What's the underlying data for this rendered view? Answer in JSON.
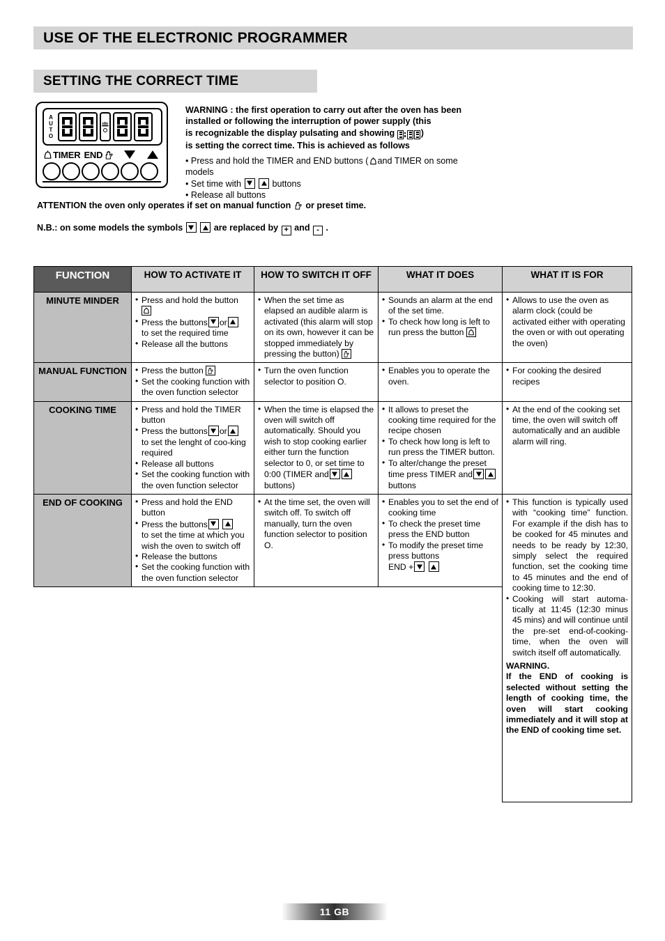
{
  "headings": {
    "main": "USE OF THE ELECTRONIC PROGRAMMER",
    "sub": "SETTING THE CORRECT TIME"
  },
  "panel": {
    "auto_label": "AUTO",
    "auto_letters": [
      "A",
      "U",
      "T",
      "O"
    ],
    "digit_value": "8",
    "labels": {
      "bell_icon": "bell-icon",
      "timer": "TIMER",
      "end": "END",
      "hand_icon": "hand-icon",
      "down_icon": "triangle-down-icon",
      "up_icon": "triangle-up-icon"
    },
    "button_count": 6
  },
  "warning": {
    "line1": "WARNING : the first operation to carry out after the oven has been",
    "line2": "installed or following the interruption of power supply (this",
    "line3_pre": "is recognizable the display pulsating and showing",
    "line3_post": ")",
    "line4": "is setting the correct time. This is achieved as follows",
    "bullet1_a": "Press and hold the TIMER and END buttons (",
    "bullet1_b": "and TIMER on some",
    "bullet1_c": "models",
    "bullet2_a": "Set time with",
    "bullet2_b": "buttons",
    "bullet3": "Release all buttons"
  },
  "attention": {
    "pre": "ATTENTION the oven only operates if set on manual function",
    "post": "or preset time."
  },
  "nb": {
    "pre": "N.B.: on some models the symbols",
    "mid": "are replaced by",
    "plus": "+",
    "and": "and",
    "minus": "-",
    "post": "."
  },
  "table": {
    "headers": [
      "FUNCTION",
      "HOW TO ACTIVATE IT",
      "HOW TO SWITCH IT OFF",
      "WHAT IT DOES",
      "WHAT IT IS FOR"
    ],
    "rows": {
      "minute_minder": {
        "name": "MINUTE MINDER",
        "activate": [
          "Press and hold the button",
          "Press the buttons",
          "to set the required time",
          "Release all the buttons"
        ],
        "switch_off": [
          "When the set time as elapsed an audible alarm is activated (this alarm will stop on its own, however it can be stopped immediately by pressing the button)"
        ],
        "does": [
          "Sounds an alarm at the end of the set time.",
          "To check how long is left to run press the button"
        ],
        "for": [
          "Allows to use the oven as alarm clock (could be activated either with operating the oven or with out operating the oven)"
        ]
      },
      "manual_function": {
        "name": "MANUAL FUNCTION",
        "activate": [
          "Press the button",
          "Set the cooking function with the oven function selector"
        ],
        "switch_off": [
          "Turn the oven function selector to position O."
        ],
        "does": [
          "Enables you to operate the oven."
        ],
        "for": [
          "For cooking the desired recipes"
        ]
      },
      "cooking_time": {
        "name": "COOKING TIME",
        "activate": [
          "Press and hold the TIMER button",
          "Press the buttons",
          "to set the lenght of coo-king required",
          "Release all buttons",
          "Set the cooking function with the oven function selector"
        ],
        "switch_off": [
          "When the time is elapsed the oven will switch off automatically. Should you wish to stop cooking earlier either turn the function selector to 0, or set time to 0:00 (TIMER and",
          "buttons)"
        ],
        "does": [
          "It allows to preset the cooking time required for the recipe chosen",
          "To check how long is left to run press the TIMER button.",
          "To alter/change the preset time press TIMER and",
          "buttons"
        ],
        "for": [
          "At the end of the cooking set time, the oven will switch off automatically and an audible alarm will ring."
        ]
      },
      "end_of_cooking": {
        "name": "END OF COOKING",
        "activate": [
          "Press and hold the END button",
          "Press the buttons",
          "to set the time at which you wish the oven to switch off",
          "Release the buttons",
          "Set the cooking function with the oven function selector"
        ],
        "switch_off": [
          "At the time set, the oven will switch off. To switch off manually, turn the oven function selector to position O."
        ],
        "does": [
          "Enables you to set the end of cooking time",
          "To check the preset time press the END button",
          "To modify the preset time press buttons",
          "END +"
        ],
        "for": [
          "This function is  typically used with “cooking time” function. For example if the dish has to be cooked for 45 minutes and needs to be ready by 12:30, simply select the required function, set the cooking time to 45 minutes and the end of cooking time to 12:30.",
          "Cooking will start automa-tically at 11:45 (12:30 minus 45 mins) and will continue until the pre-set end-of-cooking-time, when the oven will switch itself off automatically."
        ],
        "warning_head": "WARNING.",
        "warning_body": "If the END of cooking is selected without setting the length of cooking time, the oven will start cooking immediately and it will stop at the END of cooking time set."
      }
    }
  },
  "footer": {
    "page": "11 GB"
  },
  "colors": {
    "banner_bg": "#d4d4d4",
    "header_bg": "#d2d2d2",
    "function_header_bg": "#5a5a5a",
    "function_cell_bg": "#bfbfbf",
    "text": "#000000"
  }
}
